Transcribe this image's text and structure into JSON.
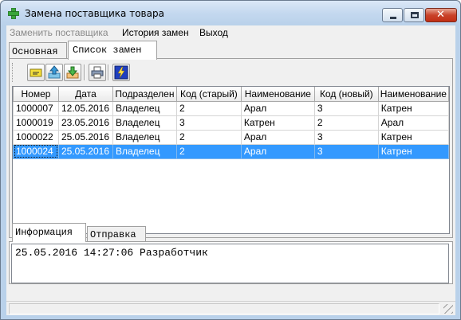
{
  "window": {
    "title": "Замена поставщика товара"
  },
  "menu": {
    "items": [
      {
        "label": "Заменить поставщика",
        "enabled": false
      },
      {
        "label": "История замен",
        "enabled": true
      },
      {
        "label": "Выход",
        "enabled": true
      }
    ]
  },
  "tabs": {
    "items": [
      {
        "label": "Основная",
        "active": false
      },
      {
        "label": "Список замен",
        "active": true
      }
    ]
  },
  "toolbar": {
    "buttons": [
      {
        "icon": "edit-form-icon"
      },
      {
        "icon": "arrow-up-icon"
      },
      {
        "icon": "arrow-down-icon"
      },
      {
        "icon": "print-icon"
      },
      {
        "icon": "lightning-icon"
      }
    ]
  },
  "grid": {
    "columns": [
      "Номер",
      "Дата",
      "Подразделен",
      "Код (старый)",
      "Наименование",
      "Код (новый)",
      "Наименование"
    ],
    "rows": [
      [
        "1000007",
        "12.05.2016",
        "Владелец",
        "2",
        "Арал",
        "3",
        "Катрен"
      ],
      [
        "1000019",
        "23.05.2016",
        "Владелец",
        "3",
        "Катрен",
        "2",
        "Арал"
      ],
      [
        "1000022",
        "25.05.2016",
        "Владелец",
        "2",
        "Арал",
        "3",
        "Катрен"
      ],
      [
        "1000024",
        "25.05.2016",
        "Владелец",
        "2",
        "Арал",
        "3",
        "Катрен"
      ]
    ],
    "selected_row": 3
  },
  "bottom_tabs": {
    "items": [
      {
        "label": "Информация",
        "active": true
      },
      {
        "label": "Отправка",
        "active": false
      }
    ]
  },
  "info": {
    "text": "25.05.2016 14:27:06 Разработчик"
  },
  "colors": {
    "selection": "#3399ff",
    "titlebar": "#c4d8ef"
  }
}
